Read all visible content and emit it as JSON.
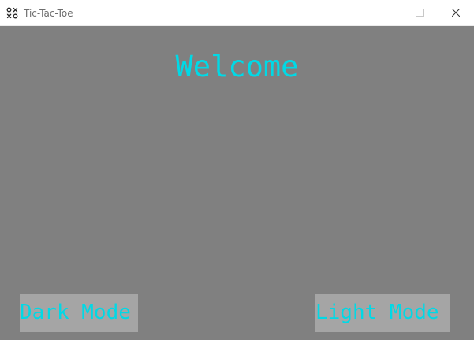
{
  "window": {
    "title": "Tic-Tac-Toe",
    "icon": "tic-tac-toe-icon"
  },
  "main": {
    "heading": "Welcome",
    "dark_mode_label": "Dark Mode",
    "light_mode_label": "Light Mode"
  },
  "colors": {
    "background": "#808080",
    "accent_text": "#00d9e6",
    "button_background": "#a5a5a5"
  }
}
